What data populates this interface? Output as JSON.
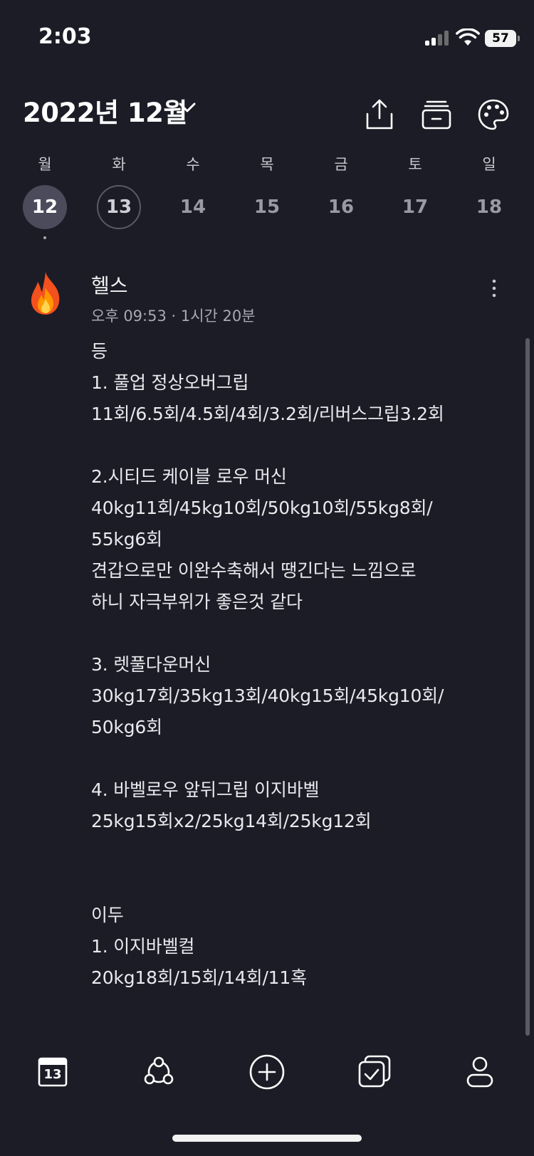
{
  "status_bar": {
    "time": "2:03",
    "battery": "57"
  },
  "header": {
    "month_title": "2022년 12월",
    "icons": [
      "share-icon",
      "archive-icon",
      "palette-icon"
    ]
  },
  "week": {
    "days": [
      {
        "name": "월",
        "num": "12",
        "state": "selected",
        "has_event": true
      },
      {
        "name": "화",
        "num": "13",
        "state": "today",
        "has_event": false
      },
      {
        "name": "수",
        "num": "14",
        "state": "",
        "has_event": false
      },
      {
        "name": "목",
        "num": "15",
        "state": "",
        "has_event": false
      },
      {
        "name": "금",
        "num": "16",
        "state": "",
        "has_event": false
      },
      {
        "name": "토",
        "num": "17",
        "state": "",
        "has_event": false
      },
      {
        "name": "일",
        "num": "18",
        "state": "",
        "has_event": false
      }
    ]
  },
  "entry": {
    "emoji": "fire-icon",
    "title": "헬스",
    "meta": "오후 09:53 · 1시간 20분",
    "body": "등\n1. 풀업 정상오버그립\n11회/6.5회/4.5회/4회/3.2회/리버스그립3.2회\n\n2.시티드 케이블 로우 머신\n40kg11회/45kg10회/50kg10회/55kg8회/\n55kg6회\n견갑으로만 이완수축해서 땡긴다는 느낌으로\n하니 자극부위가 좋은것 같다\n\n3. 렛풀다운머신\n30kg17회/35kg13회/40kg15회/45kg10회/\n50kg6회\n\n4. 바벨로우 앞뒤그립 이지바벨\n25kg15회x2/25kg14회/25kg12회\n\n\n이두\n1. 이지바벨컬\n20kg18회/15회/14회/11혹"
  },
  "tabbar": {
    "calendar_day": "13",
    "tabs": [
      "calendar-icon",
      "community-icon",
      "add-icon",
      "checklist-icon",
      "profile-icon"
    ]
  },
  "colors": {
    "background": "#1c1c26",
    "selected_day": "#4b4b5b",
    "text": "#f2f2f4",
    "muted": "#a8a8b3"
  }
}
